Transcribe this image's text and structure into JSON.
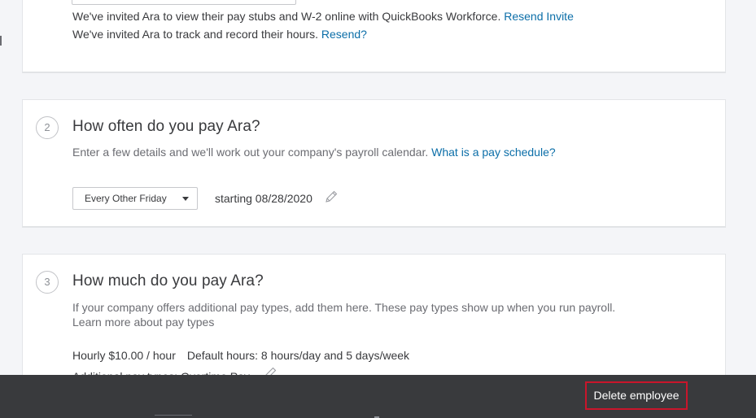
{
  "invite_section": {
    "workforce_text": "We've invited Ara to view their pay stubs and W-2 online with QuickBooks Workforce.",
    "resend_invite_link": "Resend Invite",
    "hours_text": "We've invited Ara to track and record their hours.",
    "resend_link": "Resend?"
  },
  "pay_schedule": {
    "step": "2",
    "heading": "How often do you pay Ara?",
    "subtext": "Enter a few details and we'll work out your company's payroll calendar.",
    "help_link": "What is a pay schedule?",
    "selected_schedule": "Every Other Friday",
    "start_text": "starting 08/28/2020"
  },
  "pay_amount": {
    "step": "3",
    "heading": "How much do you pay Ara?",
    "subtext": "If your company offers additional pay types, add them here. These pay types show up when you run payroll.",
    "help_link": "Learn more about pay types",
    "hourly_rate": "Hourly $10.00 / hour",
    "default_hours": "Default hours: 8 hours/day and 5 days/week",
    "additional_pay_types": "Additional pay types: Overtime Pay"
  },
  "footer": {
    "delete_button": "Delete employee"
  },
  "colors": {
    "link": "#0b6ea8",
    "footer_bg": "#393a3d",
    "highlight": "#c9152b"
  }
}
